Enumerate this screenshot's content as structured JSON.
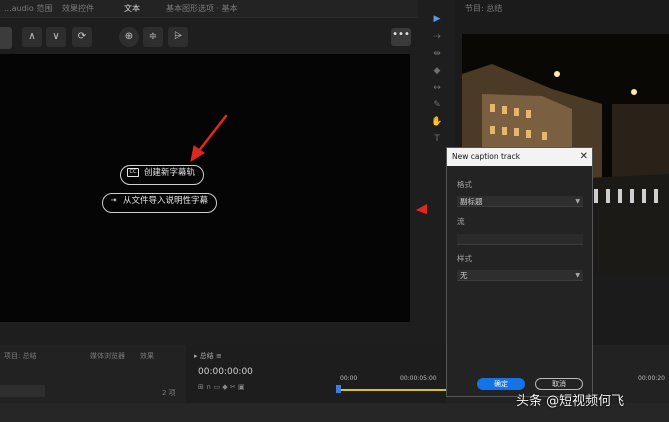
{
  "tabs": [
    "...audio 范围",
    "效果控件",
    "文本",
    "基本图形选项 · 基本"
  ],
  "monitor": {
    "title": "节目: 总结"
  },
  "caption_panel": {
    "create_button": "创建新字幕轨",
    "import_button": "从文件导入说明性字幕",
    "cc_icon": "CC"
  },
  "dialog": {
    "title": "New caption track",
    "format_label": "格式",
    "format_value": "副标题",
    "stream_label": "流",
    "style_label": "样式",
    "style_value": "无",
    "ok_label": "确定",
    "cancel_label": "取消"
  },
  "bottom": {
    "panel_a": "项目: 总结",
    "panel_b": "媒体浏览器",
    "panel_c": "效果",
    "item_count": "2 项",
    "timecode": "00:00:00:00",
    "ruler_start": "00:00",
    "ruler_mid": "00:00:05:00",
    "ruler_end": "00:00:20"
  },
  "watermark": "头条 @短视频何飞",
  "colors": {
    "accent": "#1473e6",
    "arrow": "#e0281e",
    "timeline_bar": "#d9c21c"
  }
}
